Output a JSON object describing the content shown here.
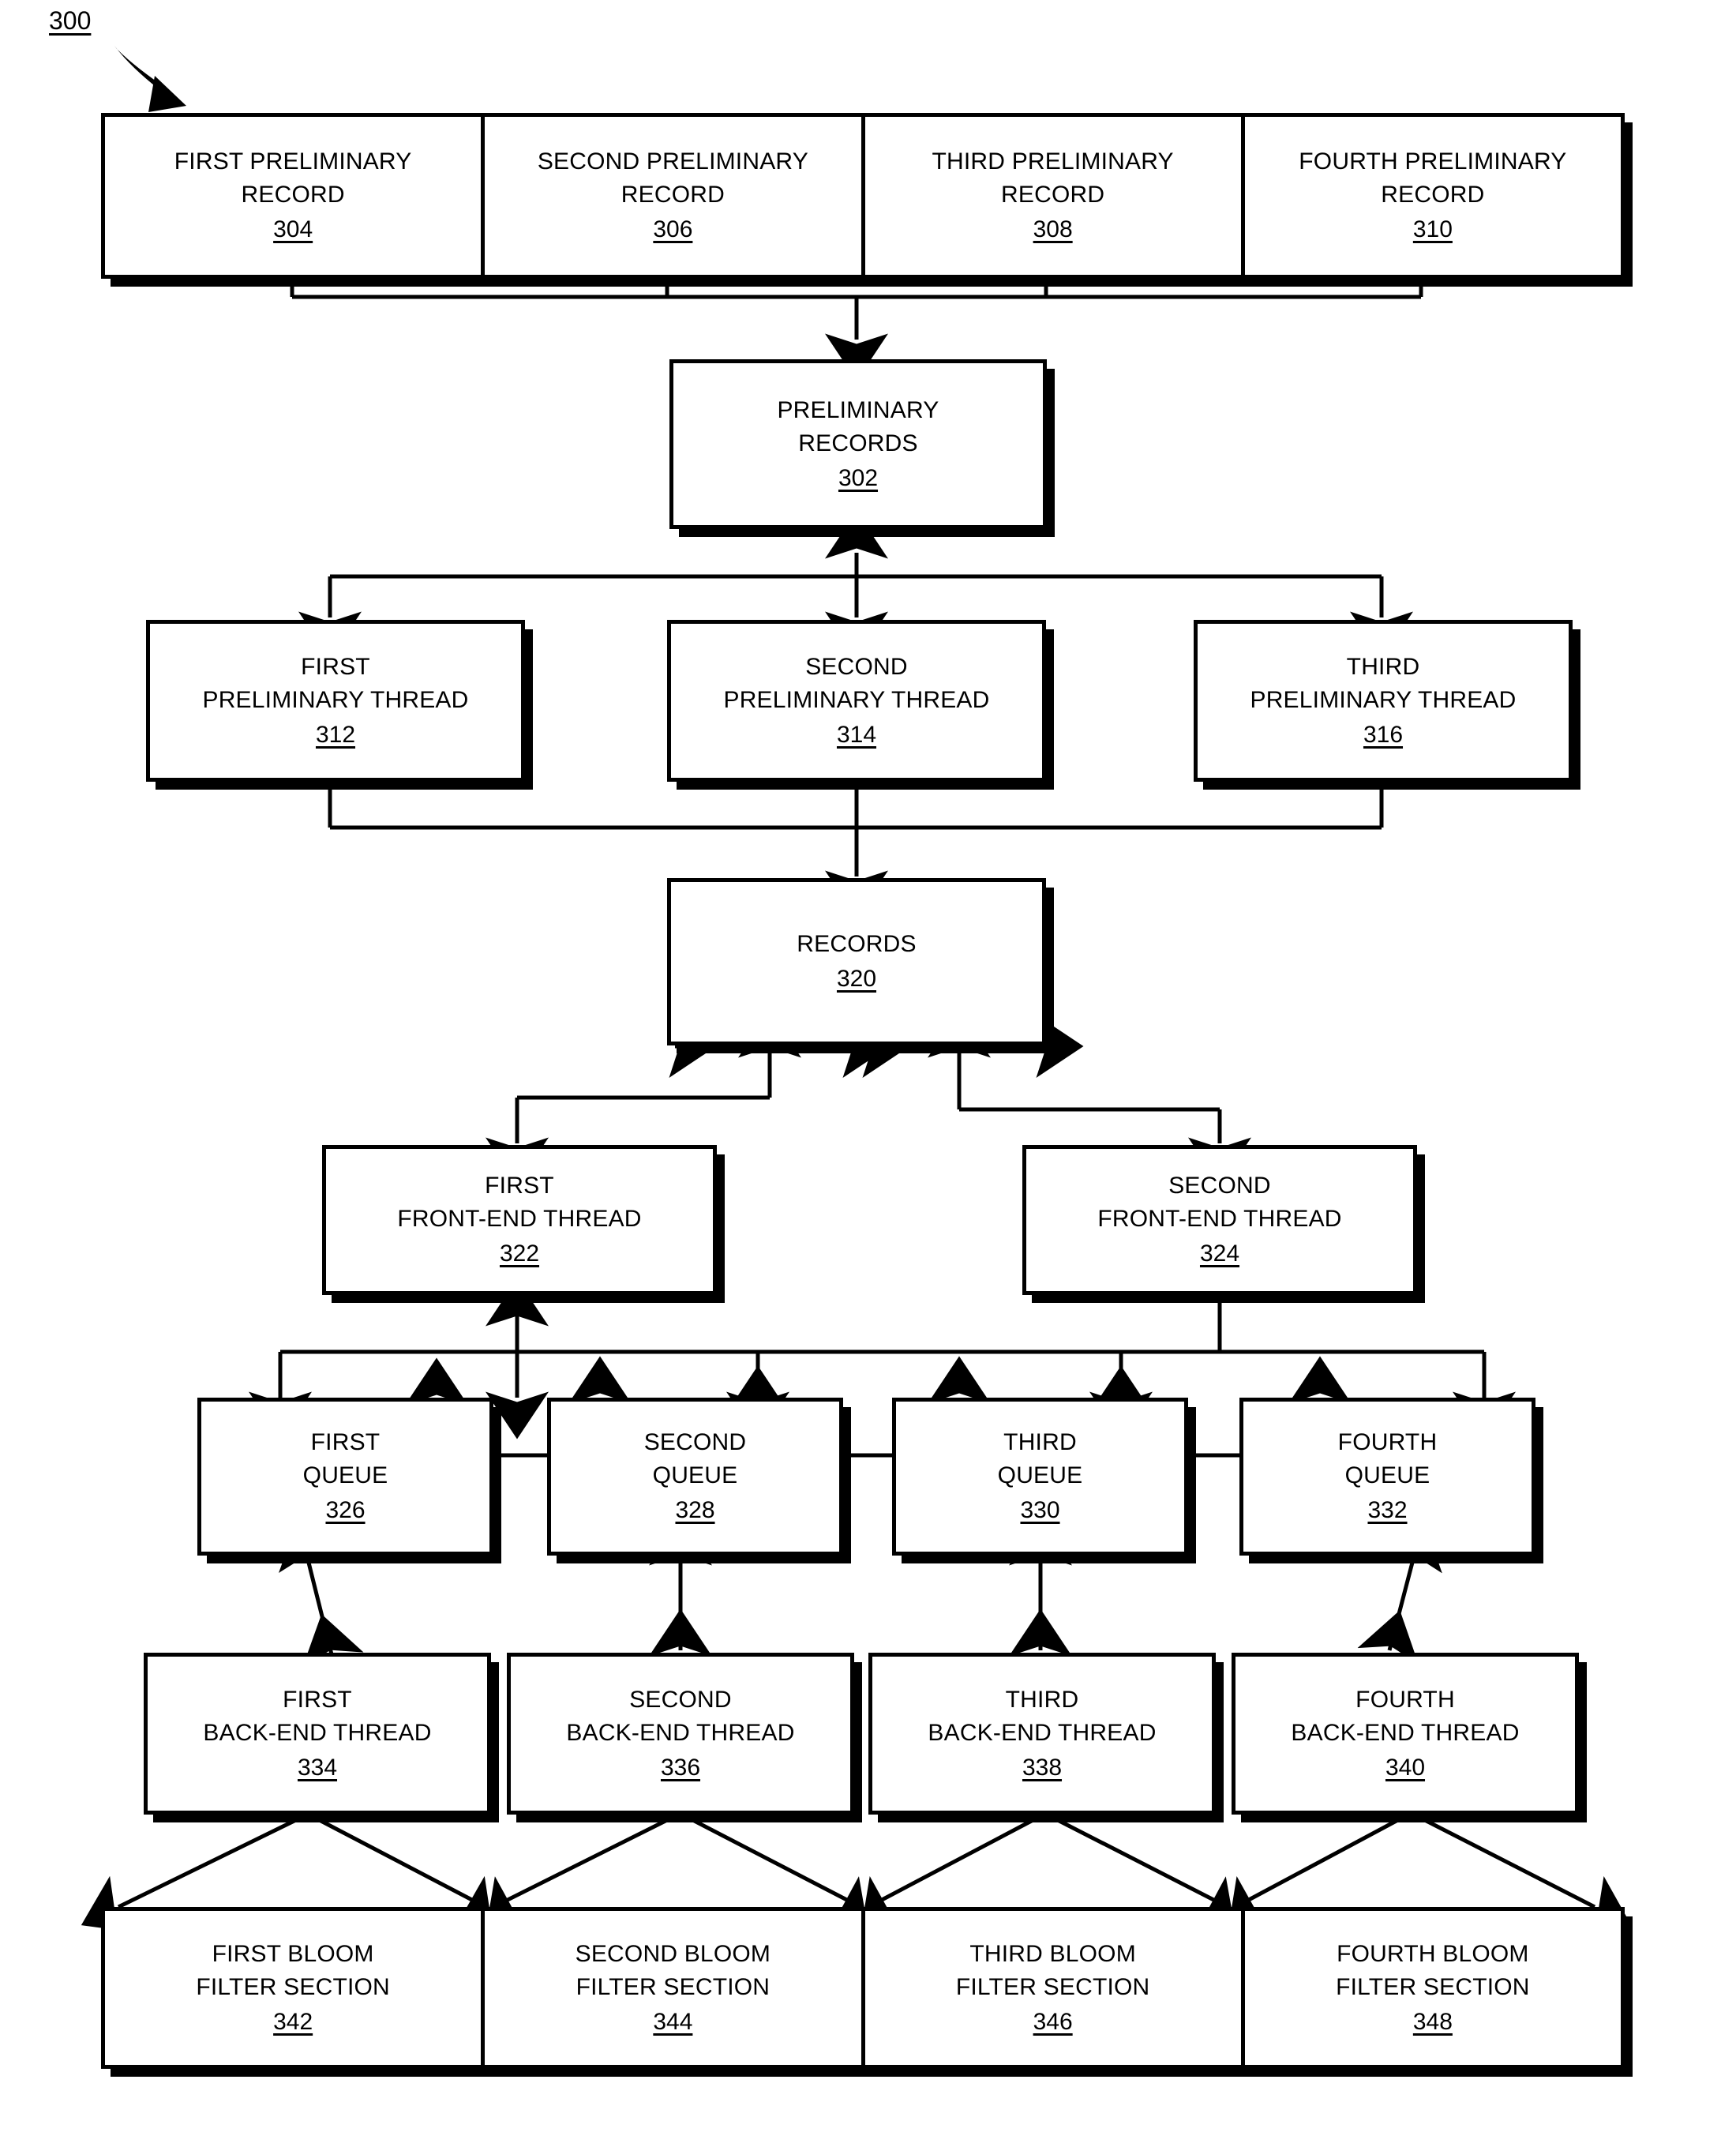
{
  "figure": {
    "number": "300",
    "type": "patent-flow-diagram"
  },
  "nodes": {
    "preliminary_record_1": {
      "title": "FIRST PRELIMINARY\nRECORD",
      "ref": "304"
    },
    "preliminary_record_2": {
      "title": "SECOND PRELIMINARY\nRECORD",
      "ref": "306"
    },
    "preliminary_record_3": {
      "title": "THIRD PRELIMINARY\nRECORD",
      "ref": "308"
    },
    "preliminary_record_4": {
      "title": "FOURTH PRELIMINARY\nRECORD",
      "ref": "310"
    },
    "preliminary_records": {
      "title": "PRELIMINARY\nRECORDS",
      "ref": "302"
    },
    "preliminary_thread_1": {
      "title": "FIRST\nPRELIMINARY THREAD",
      "ref": "312"
    },
    "preliminary_thread_2": {
      "title": "SECOND\nPRELIMINARY THREAD",
      "ref": "314"
    },
    "preliminary_thread_3": {
      "title": "THIRD\nPRELIMINARY THREAD",
      "ref": "316"
    },
    "records": {
      "title": "RECORDS",
      "ref": "320"
    },
    "front_end_thread_1": {
      "title": "FIRST\nFRONT-END THREAD",
      "ref": "322"
    },
    "front_end_thread_2": {
      "title": "SECOND\nFRONT-END THREAD",
      "ref": "324"
    },
    "queue_1": {
      "title": "FIRST\nQUEUE",
      "ref": "326"
    },
    "queue_2": {
      "title": "SECOND\nQUEUE",
      "ref": "328"
    },
    "queue_3": {
      "title": "THIRD\nQUEUE",
      "ref": "330"
    },
    "queue_4": {
      "title": "FOURTH\nQUEUE",
      "ref": "332"
    },
    "back_end_thread_1": {
      "title": "FIRST\nBACK-END THREAD",
      "ref": "334"
    },
    "back_end_thread_2": {
      "title": "SECOND\nBACK-END THREAD",
      "ref": "336"
    },
    "back_end_thread_3": {
      "title": "THIRD\nBACK-END THREAD",
      "ref": "338"
    },
    "back_end_thread_4": {
      "title": "FOURTH\nBACK-END THREAD",
      "ref": "340"
    },
    "bloom_1": {
      "title": "FIRST BLOOM\nFILTER SECTION",
      "ref": "342"
    },
    "bloom_2": {
      "title": "SECOND BLOOM\nFILTER SECTION",
      "ref": "344"
    },
    "bloom_3": {
      "title": "THIRD BLOOM\nFILTER SECTION",
      "ref": "346"
    },
    "bloom_4": {
      "title": "FOURTH BLOOM\nFILTER SECTION",
      "ref": "348"
    }
  },
  "colors": {
    "stroke": "#000000",
    "fill": "#ffffff"
  }
}
